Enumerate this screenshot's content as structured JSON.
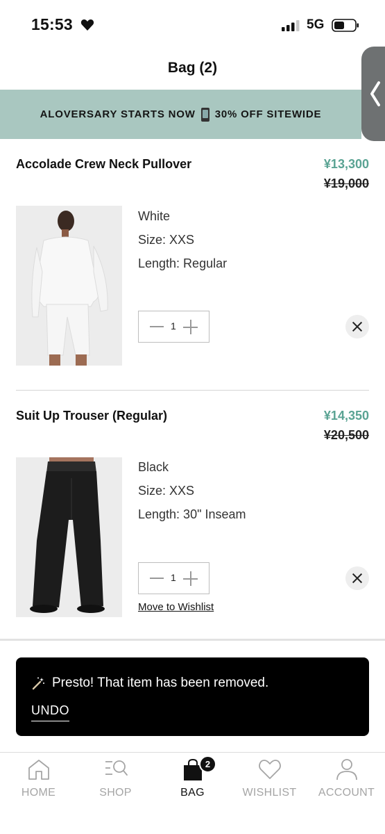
{
  "status_bar": {
    "time": "15:53",
    "network": "5G"
  },
  "header": {
    "title": "Bag (2)"
  },
  "promo": {
    "text_left": "ALOVERSARY STARTS NOW",
    "text_right": "30% OFF SITEWIDE"
  },
  "items": [
    {
      "name": "Accolade Crew Neck Pullover",
      "sale_price": "¥13,300",
      "original_price": "¥19,000",
      "color": "White",
      "size": "Size: XXS",
      "length": "Length: Regular",
      "quantity": "1"
    },
    {
      "name": "Suit Up Trouser (Regular)",
      "sale_price": "¥14,350",
      "original_price": "¥20,500",
      "color": "Black",
      "size": "Size: XXS",
      "length": "Length: 30\" Inseam",
      "quantity": "1",
      "wishlist_link": "Move to Wishlist"
    }
  ],
  "toast": {
    "message": "Presto! That item has been removed.",
    "undo_label": "UNDO"
  },
  "tabbar": {
    "tabs": [
      {
        "label": "HOME",
        "icon": "home-icon"
      },
      {
        "label": "SHOP",
        "icon": "shop-search-icon"
      },
      {
        "label": "BAG",
        "icon": "bag-icon",
        "badge": "2"
      },
      {
        "label": "WISHLIST",
        "icon": "heart-icon"
      },
      {
        "label": "ACCOUNT",
        "icon": "person-icon"
      }
    ]
  },
  "colors": {
    "accent_green": "#5aa393",
    "promo_bg": "#a9c7c0"
  }
}
